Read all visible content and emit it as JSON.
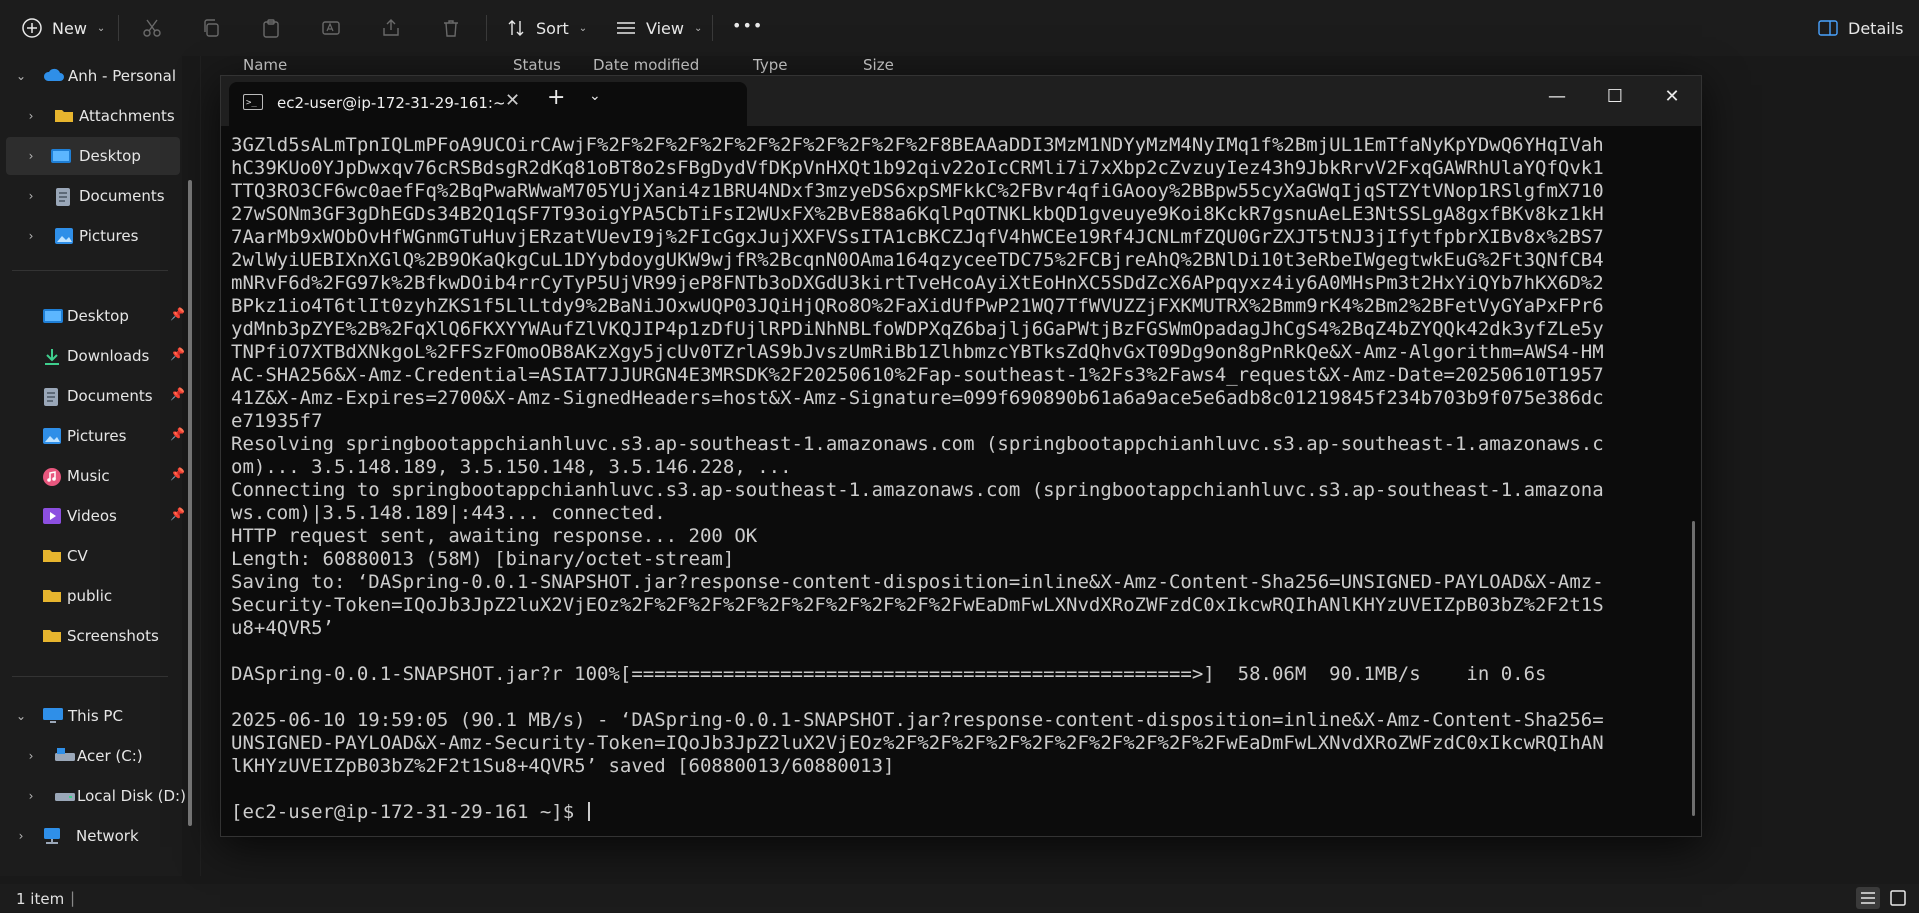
{
  "toolbar": {
    "new_label": "New",
    "sort_label": "Sort",
    "view_label": "View",
    "more_label": "•••",
    "details_label": "Details"
  },
  "columns": [
    "Name",
    "Status",
    "Date modified",
    "Type",
    "Size"
  ],
  "sidebar": {
    "tree": [
      {
        "label": "Anh - Personal",
        "expanded": true
      },
      {
        "label": "Attachments"
      },
      {
        "label": "Desktop",
        "selected": true
      },
      {
        "label": "Documents"
      },
      {
        "label": "Pictures"
      }
    ],
    "quick_access": [
      {
        "label": "Desktop",
        "pinned": true
      },
      {
        "label": "Downloads",
        "pinned": true
      },
      {
        "label": "Documents",
        "pinned": true
      },
      {
        "label": "Pictures",
        "pinned": true
      },
      {
        "label": "Music",
        "pinned": true
      },
      {
        "label": "Videos",
        "pinned": true
      },
      {
        "label": "CV"
      },
      {
        "label": "public"
      },
      {
        "label": "Screenshots"
      }
    ],
    "this_pc": [
      {
        "label": "This PC",
        "expanded": true
      },
      {
        "label": "Acer (C:)"
      },
      {
        "label": "Local Disk (D:)"
      },
      {
        "label": "Network"
      }
    ]
  },
  "statusbar": {
    "item_count": "1 item",
    "separator": "|"
  },
  "terminal": {
    "tab_title": "ec2-user@ip-172-31-29-161:~",
    "lines": [
      "3GZld5sALmTpnIQLmPFoA9UCOirCAwjF%2F%2F%2F%2F%2F%2F%2F%2F%2F%2F8BEAAaDDI3MzM1NDYyMzM4NyIMq1f%2BmjUL1EmTfaNyKpYDwQ6YHqIVah",
      "hC39KUo0YJpDwxqv76cRSBdsgR2dKq81oBT8o2sFBgDydVfDKpVnHXQt1b92qiv22oIcCRMli7i7xXbp2cZvzuyIez43h9JbkRrvV2FxqGAWRhUlaYQfQvk1",
      "TTQ3RO3CF6wc0aefFq%2BqPwaRWwaM705YUjXani4z1BRU4NDxf3mzyeDS6xpSMFkkC%2FBvr4qfiGAooy%2BBpw55cyXaGWqIjqSTZYtVNop1RSlgfmX710",
      "27wSONm3GF3gDhEGDs34B2Q1qSF7T93oigYPA5CbTiFsI2WUxFX%2BvE88a6KqlPqOTNKLkbQD1gveuye9Koi8KckR7gsnuAeLE3NtSSLgA8gxfBKv8kz1kH",
      "7AarMb9xWObOvHfWGnmGTuHuvjERzatVUevI9j%2FIcGgxJujXXFVSsITA1cBKCZJqfV4hWCEe19Rf4JCNLmfZQU0GrZXJT5tNJ3jIfytfpbrXIBv8x%2BS7",
      "2wlWyiUEBIXnXGlQ%2B9OKaQkgCuL1DYybdoygUKW9wjfR%2BcqnN0OAma164qzyceeTDC75%2FCBjreAhQ%2BNlDi10t3eRbeIWgegtwkEuG%2Ft3QNfCB4",
      "mNRvF6d%2FG97k%2BfkwDOib4rrCyTyP5UjVR99jeP8FNTb3oDXGdU3kirtTveHcoAyiXtEoHnXC5SDdZcX6APpqyxz4iy6A0MHsPm3t2HxYiQYb7hKX6D%2",
      "BPkz1io4T6tlIt0zyhZKS1f5LlLtdy9%2BaNiJOxwUQP03JQiHjQRo8O%2FaXidUfPwP21WQ7TfWVUZZjFXKMUTRX%2Bmm9rK4%2Bm2%2BFetVyGYaPxFPr6",
      "ydMnb3pZYE%2B%2FqXlQ6FKXYYWAufZlVKQJIP4p1zDfUjlRPDiNhNBLfoWDPXqZ6bajlj6GaPWtjBzFGSWmOpadagJhCgS4%2BqZ4bZYQQk42dk3yfZLe5y",
      "TNPfiO7XTBdXNkgoL%2FFSzFOmoOB8AKzXgy5jcUv0TZrlAS9bJvszUmRiBb1ZlhbmzcYBTksZdQhvGxT09Dg9on8gPnRkQe&X-Amz-Algorithm=AWS4-HM",
      "AC-SHA256&X-Amz-Credential=ASIAT7JJURGN4E3MRSDK%2F20250610%2Fap-southeast-1%2Fs3%2Faws4_request&X-Amz-Date=20250610T1957",
      "41Z&X-Amz-Expires=2700&X-Amz-SignedHeaders=host&X-Amz-Signature=099f690890b61a6a9ace5e6adb8c01219845f234b703b9f075e386dc",
      "e71935f7",
      "Resolving springbootappchianhluvc.s3.ap-southeast-1.amazonaws.com (springbootappchianhluvc.s3.ap-southeast-1.amazonaws.c",
      "om)... 3.5.148.189, 3.5.150.148, 3.5.146.228, ...",
      "Connecting to springbootappchianhluvc.s3.ap-southeast-1.amazonaws.com (springbootappchianhluvc.s3.ap-southeast-1.amazona",
      "ws.com)|3.5.148.189|:443... connected.",
      "HTTP request sent, awaiting response... 200 OK",
      "Length: 60880013 (58M) [binary/octet-stream]",
      "Saving to: ‘DASpring-0.0.1-SNAPSHOT.jar?response-content-disposition=inline&X-Amz-Content-Sha256=UNSIGNED-PAYLOAD&X-Amz-",
      "Security-Token=IQoJb3JpZ2luX2VjEOz%2F%2F%2F%2F%2F%2F%2F%2F%2F%2FwEaDmFwLXNvdXRoZWFzdC0xIkcwRQIhANlKHYzUVEIZpB03bZ%2F2t1S",
      "u8+4QVR5’",
      "",
      "DASpring-0.0.1-SNAPSHOT.jar?r 100%[=================================================>]  58.06M  90.1MB/s    in 0.6s",
      "",
      "2025-06-10 19:59:05 (90.1 MB/s) - ‘DASpring-0.0.1-SNAPSHOT.jar?response-content-disposition=inline&X-Amz-Content-Sha256=",
      "UNSIGNED-PAYLOAD&X-Amz-Security-Token=IQoJb3JpZ2luX2VjEOz%2F%2F%2F%2F%2F%2F%2F%2F%2F%2FwEaDmFwLXNvdXRoZWFzdC0xIkcwRQIhAN",
      "lKHYzUVEIZpB03bZ%2F2t1Su8+4QVR5’ saved [60880013/60880013]",
      "",
      "[ec2-user@ip-172-31-29-161 ~]$ "
    ]
  }
}
